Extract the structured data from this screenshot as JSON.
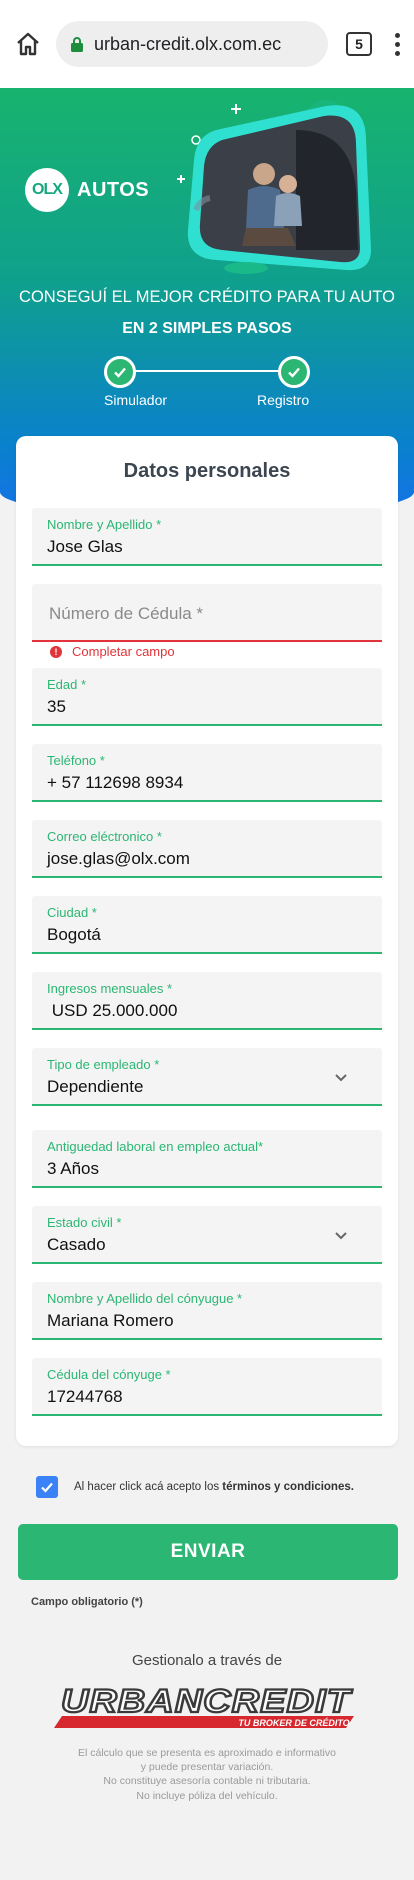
{
  "browser": {
    "url": "urban-credit.olx.com.ec",
    "tab_count": "5"
  },
  "hero": {
    "logo_mark": "OLX",
    "logo_text": "AUTOS",
    "title": "CONSEGUÍ EL MEJOR CRÉDITO PARA TU AUTO",
    "subtitle": "EN 2 SIMPLES PASOS",
    "steps": [
      {
        "label": "Simulador"
      },
      {
        "label": "Registro"
      }
    ]
  },
  "form": {
    "title": "Datos personales",
    "fields": [
      {
        "label": "Nombre y Apellido *",
        "value": "Jose Glas"
      },
      {
        "placeholder": "Número de Cédula *",
        "error": "Completar campo"
      },
      {
        "label": "Edad *",
        "value": "35"
      },
      {
        "label": "Teléfono *",
        "value": "+ 57 112698 8934"
      },
      {
        "label": "Correo eléctronico *",
        "value": "jose.glas@olx.com"
      },
      {
        "label": "Ciudad *",
        "value": "Bogotá"
      },
      {
        "label": "Ingresos mensuales *",
        "value": " USD 25.000.000"
      },
      {
        "label": "Tipo de empleado *",
        "value": "Dependiente"
      },
      {
        "label": "Antiguedad laboral en empleo actual*",
        "value": "3 Años"
      },
      {
        "label": "Estado civil *",
        "value": "Casado"
      },
      {
        "label": "Nombre y Apellido del cónyugue *",
        "value": "Mariana Romero"
      },
      {
        "label": "Cédula del cónyuge *",
        "value": "17244768"
      }
    ]
  },
  "terms": {
    "text_prefix": "Al hacer click acá acepto los ",
    "link_text": "términos y condiciones."
  },
  "submit_label": "ENVIAR",
  "required_note": "Campo obligatorio (*)",
  "footer": {
    "manage_text": "Gestionalo a través de",
    "brand_name": "URBANCREDIT",
    "brand_tagline": "TU BROKER DE CRÉDITO",
    "disclaimer_lines": [
      "El cálculo que se presenta es aproximado e informativo",
      "y puede presentar variación.",
      "No constituye asesoría contable ni tributaria.",
      "No incluye póliza del vehículo."
    ]
  },
  "colors": {
    "accent_green": "#2bb673",
    "error_red": "#e0343a",
    "checkbox_blue": "#3b82f6"
  }
}
